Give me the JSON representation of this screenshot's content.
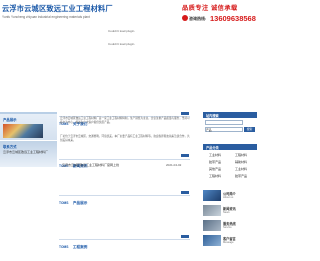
{
  "header": {
    "company_cn": "云浮市云城区致远工业工程材料厂",
    "company_en": "Yunfu Yuncheng zhiyuan industrial engineering materials plant",
    "slogan": "品质专注 诚信承载",
    "hotline_label": "咨询热线:",
    "hotline_number": "13609638568"
  },
  "placeholders": {
    "nav": "Couldn't load plugin.",
    "banner": "Couldn't load plugin."
  },
  "left": {
    "panel1_title": "产品展示",
    "panel2_title": "联系方式",
    "panel2_text": "云浮市云城区致远工业工程材料厂"
  },
  "about": {
    "title_en": "TOMS",
    "title_cn": "关于我们",
    "text1": "云浮市云城区致远工业工程材料厂是一家工业工程材料特制，生产销售为主业，企业注重产品质量与服务，坚持以客户为中心，竭诚为广大客户提供优质产品。",
    "text2": "厂址位于云浮市云城区，交通便利，环境优美。本厂主要产品有工业工程材料等，欢迎各界朋友前来洽谈合作，共创美好未来。"
  },
  "news": {
    "title_en": "TOMS",
    "title_cn": "新闻资讯",
    "item": "云浮市云城区致远工业工程材料厂官网上线",
    "date": "2021-04-02"
  },
  "products": {
    "title_en": "TOMS",
    "title_cn": "产品展示"
  },
  "cases": {
    "title_en": "TOMS",
    "title_cn": "工程案例"
  },
  "right": {
    "search_title": "站内搜索",
    "search_select": "产品",
    "search_button": "搜索",
    "cat_title": "产品分类",
    "categories": [
      "工业材料",
      "工程材料",
      "胶带产品",
      "辅助材料",
      "其他产品",
      "工业材料",
      "工程材料",
      "胶带产品"
    ],
    "side_news": [
      {
        "title": "公司简介",
        "sub": "About us"
      },
      {
        "title": "新闻资讯",
        "sub": "News"
      },
      {
        "title": "服务热线",
        "sub": "Service"
      },
      {
        "title": "客户留言",
        "sub": "Message"
      }
    ]
  },
  "colors": {
    "brand_blue": "#1a58a8",
    "accent_red": "#d61a1a",
    "panel_blue": "#2a5da0"
  }
}
